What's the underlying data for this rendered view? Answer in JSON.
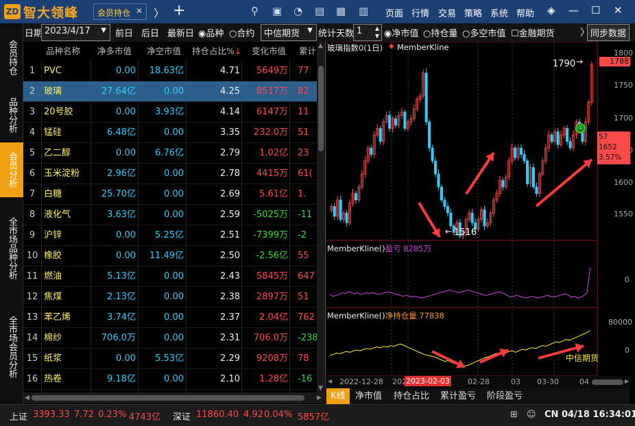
{
  "app": {
    "logo_badge": "ZD",
    "name": "智大领峰",
    "tab_label": "会员持仓",
    "tab_close": "✕",
    "tab_next": "〉",
    "tab_add": "+"
  },
  "menu": [
    "页面",
    "行情",
    "交易",
    "策略",
    "系统",
    "帮助"
  ],
  "toolbar": {
    "date_label": "日期",
    "date_value": "2023/4/17",
    "prev_day": "前日",
    "next_day": "后日",
    "latest_day": "最新日",
    "radio_variety": "品种",
    "radio_contract": "合约",
    "broker": "中信期货",
    "stat_days_label": "统计天数",
    "stat_days_value": "1",
    "opt_net": "净市值",
    "opt_pos": "持仓量",
    "opt_ls": "多空市值",
    "opt_fin": "金融期货",
    "sync_btn": "同步数据"
  },
  "sidebar": [
    "会员持仓",
    "品种分析",
    "会员分析",
    "全市场品种分析",
    "全市场会员分析"
  ],
  "table": {
    "headers": [
      "品种名称",
      "净多市值",
      "净空市值",
      "持仓占比%",
      "变化市值",
      "累计"
    ],
    "rows": [
      {
        "idx": "1",
        "name": "PVC",
        "long": "0.00",
        "short": "18.63亿",
        "pct": "4.71",
        "chg": "5649万",
        "cum": "77"
      },
      {
        "idx": "2",
        "name": "玻璃",
        "long": "27.64亿",
        "short": "0.00",
        "pct": "4.25",
        "chg": "8517万",
        "cum": "82"
      },
      {
        "idx": "3",
        "name": "20号胶",
        "long": "0.00",
        "short": "3.93亿",
        "pct": "4.14",
        "chg": "6147万",
        "cum": "11"
      },
      {
        "idx": "4",
        "name": "锰硅",
        "long": "6.48亿",
        "short": "0.00",
        "pct": "3.35",
        "chg": "232.0万",
        "cum": "51"
      },
      {
        "idx": "5",
        "name": "乙二醇",
        "long": "0.00",
        "short": "6.76亿",
        "pct": "2.79",
        "chg": "1.02亿",
        "cum": "23"
      },
      {
        "idx": "6",
        "name": "玉米淀粉",
        "long": "2.96亿",
        "short": "0.00",
        "pct": "2.78",
        "chg": "4415万",
        "cum": "61("
      },
      {
        "idx": "7",
        "name": "白糖",
        "long": "25.70亿",
        "short": "0.00",
        "pct": "2.69",
        "chg": "5.61亿",
        "cum": "1."
      },
      {
        "idx": "8",
        "name": "液化气",
        "long": "3.63亿",
        "short": "0.00",
        "pct": "2.59",
        "chg": "-5025万",
        "cum": "-11"
      },
      {
        "idx": "9",
        "name": "沪锌",
        "long": "0.00",
        "short": "5.25亿",
        "pct": "2.51",
        "chg": "-7399万",
        "cum": "-2"
      },
      {
        "idx": "10",
        "name": "橡胶",
        "long": "0.00",
        "short": "11.49亿",
        "pct": "2.50",
        "chg": "-2.56亿",
        "cum": "55"
      },
      {
        "idx": "11",
        "name": "燃油",
        "long": "5.13亿",
        "short": "0.00",
        "pct": "2.43",
        "chg": "5845万",
        "cum": "647"
      },
      {
        "idx": "12",
        "name": "焦煤",
        "long": "2.13亿",
        "short": "0.00",
        "pct": "2.38",
        "chg": "2897万",
        "cum": "51"
      },
      {
        "idx": "13",
        "name": "苯乙烯",
        "long": "3.74亿",
        "short": "0.00",
        "pct": "2.37",
        "chg": "2.04亿",
        "cum": "762"
      },
      {
        "idx": "14",
        "name": "棉纱",
        "long": "706.0万",
        "short": "0.00",
        "pct": "2.31",
        "chg": "706.0万",
        "cum": "-238"
      },
      {
        "idx": "15",
        "name": "纸浆",
        "long": "0.00",
        "short": "5.53亿",
        "pct": "2.29",
        "chg": "9208万",
        "cum": "78"
      },
      {
        "idx": "16",
        "name": "热卷",
        "long": "9.18亿",
        "short": "0.00",
        "pct": "2.10",
        "chg": "1.28亿",
        "cum": "-16"
      }
    ]
  },
  "chart": {
    "title": "玻璃指数0(1日)",
    "indicator": "MemberKline",
    "high_label": "1790",
    "low_label": "1516",
    "price_ticks": [
      "1800",
      "1750",
      "1700",
      "1650",
      "1600",
      "1550"
    ],
    "current_price": "1788",
    "info_box": [
      "57",
      "1652",
      "3.57%"
    ],
    "panel2_name": "MemberKline()",
    "panel2_label": "盈亏",
    "panel2_value": "8285万",
    "panel2_tick": "0",
    "panel3_name": "MemberKline()",
    "panel3_label": "净持仓量",
    "panel3_value": "77838",
    "panel3_ticks": [
      "80000",
      "0"
    ],
    "panel3_annot": "中信期货",
    "dates": [
      "2022-12-28",
      "202",
      "2023-02-03",
      "02-28",
      "03",
      "03-30",
      "04"
    ],
    "colors": {
      "up": "#ff4a4a",
      "down": "#33ccff",
      "pnl": "#d040e0",
      "netpos_up": "#ff9922",
      "netpos_down": "#ffee33",
      "arrow": "#ff3b3b"
    }
  },
  "bottom_tabs": [
    "K线",
    "净市值",
    "持仓占比",
    "累计盈亏",
    "阶段盈亏"
  ],
  "status": {
    "sh_label": "上证",
    "sh_price": "3393.33",
    "sh_chg": "7.72",
    "sh_pct": "0.23%",
    "sh_amt": "4743亿",
    "sz_label": "深证",
    "sz_price": "11860.40",
    "sz_chg": "4.92",
    "sz_pct": "0.04%",
    "sz_amt": "5857亿",
    "clock": "CN 04/18 16:34:01"
  }
}
